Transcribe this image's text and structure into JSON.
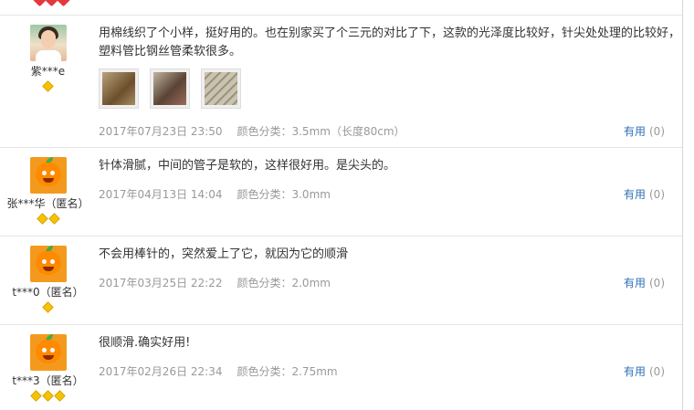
{
  "reviews": [
    {
      "username": "紫***e",
      "avatar": "user-photo",
      "rank_gems": 1,
      "text": "用棉线织了个小样，挺好用的。也在别家买了个三元的对比了下，这款的光泽度比较好，针尖处处理的比较好，塑料管比钢丝管柔软很多。",
      "has_images": true,
      "image_count": 3,
      "date": "2017年07月23日 23:50",
      "spec": "颜色分类：3.5mm（长度80cm）",
      "useful_label": "有用",
      "useful_count": "(0)"
    },
    {
      "username": "张***华（匿名）",
      "avatar": "mascot",
      "rank_gems": 2,
      "text": "针体滑腻，中间的管子是软的，这样很好用。是尖头的。",
      "date": "2017年04月13日 14:04",
      "spec": "颜色分类：3.0mm",
      "useful_label": "有用",
      "useful_count": "(0)"
    },
    {
      "username": "t***0（匿名）",
      "avatar": "mascot",
      "rank_gems": 1,
      "text": "不会用棒针的，突然爱上了它，就因为它的顺滑",
      "date": "2017年03月25日 22:22",
      "spec": "颜色分类：2.0mm",
      "useful_label": "有用",
      "useful_count": "(0)"
    },
    {
      "username": "t***3（匿名）",
      "avatar": "mascot",
      "rank_gems": 3,
      "text": "很顺滑.确实好用!",
      "date": "2017年02月26日 22:34",
      "spec": "颜色分类：2.75mm",
      "useful_label": "有用",
      "useful_count": "(0)"
    }
  ],
  "colors": {
    "link": "#2f6fb7",
    "muted": "#999999",
    "divider": "#e5e5e5",
    "gem": "#f4c300",
    "heart": "#e4393c"
  }
}
